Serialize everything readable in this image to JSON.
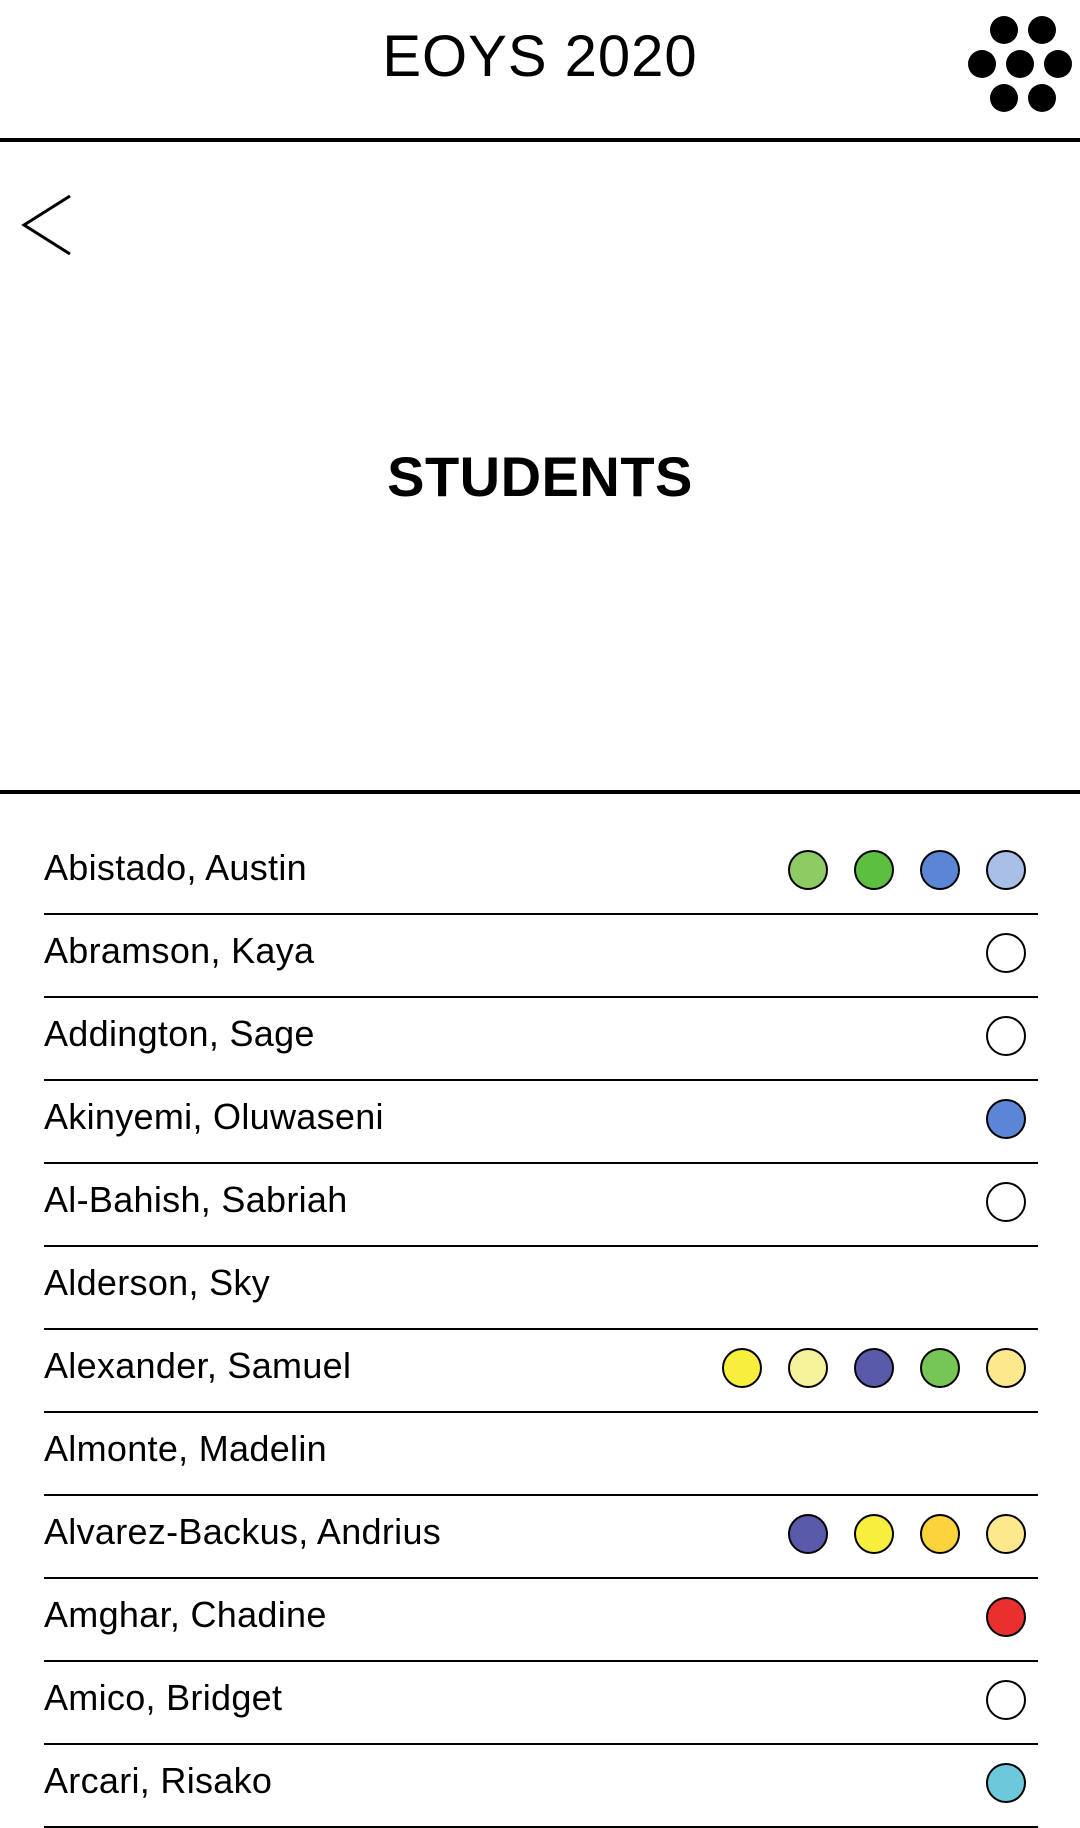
{
  "header": {
    "title": "EOYS 2020",
    "menu_icon": "dots-menu-icon"
  },
  "nav": {
    "back_icon": "chevron-left-icon"
  },
  "page": {
    "title": "STUDENTS"
  },
  "students": [
    {
      "name": "Abistado, Austin",
      "dots": [
        "#8ccc63",
        "#5cbf3f",
        "#5b86d6",
        "#a9bfe8"
      ]
    },
    {
      "name": "Abramson, Kaya",
      "dots": [
        "#ffffff"
      ]
    },
    {
      "name": "Addington, Sage",
      "dots": [
        "#ffffff"
      ]
    },
    {
      "name": "Akinyemi, Oluwaseni",
      "dots": [
        "#5b86d6"
      ]
    },
    {
      "name": "Al-Bahish, Sabriah",
      "dots": [
        "#ffffff"
      ]
    },
    {
      "name": "Alderson, Sky",
      "dots": []
    },
    {
      "name": "Alexander, Samuel",
      "dots": [
        "#f8ee3e",
        "#f7f29c",
        "#5a5aab",
        "#76c656",
        "#fde88e"
      ]
    },
    {
      "name": "Almonte, Madelin",
      "dots": []
    },
    {
      "name": "Alvarez-Backus, Andrius",
      "dots": [
        "#5a5aab",
        "#f8ee3e",
        "#fbd43c",
        "#fde88e"
      ]
    },
    {
      "name": "Amghar, Chadine",
      "dots": [
        "#e8312f"
      ]
    },
    {
      "name": "Amico, Bridget",
      "dots": [
        "#ffffff"
      ]
    },
    {
      "name": "Arcari, Risako",
      "dots": [
        "#6cc9dc"
      ]
    }
  ]
}
